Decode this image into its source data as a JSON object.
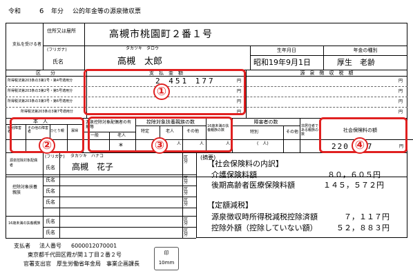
{
  "header": {
    "era": "令和",
    "year": "6",
    "year_unit": "年分",
    "title": "公的年金等の源泉徴収票"
  },
  "recipient": {
    "side_label": "支払を受ける者",
    "address_label": "住所又は居所",
    "address": "高槻市桃園町２番１号",
    "furigana_label": "(フリガナ)",
    "furigana": "タカツキ　タロウ",
    "name_label": "氏名",
    "name": "高槻　太郎",
    "birthdate_label": "生年月日",
    "birthdate": "昭和19年9月1日",
    "pension_type_label": "年金の種別",
    "pension_type": "厚生　老齢"
  },
  "payment": {
    "category_label": "区　　分",
    "amount_label": "支　払　金　額",
    "withholding_label": "源　泉　徴　収　税　額",
    "rows": [
      {
        "label": "所得税法第203条の3第1号・第4号適用分",
        "amount": "2 451 177",
        "unit": "円",
        "tax_unit": "円"
      },
      {
        "label": "所得税法第203条の3第2号・第5号適用分",
        "amount": "",
        "unit": "円",
        "tax_unit": "円"
      },
      {
        "label": "所得税法第203条の3第3号・第6号適用分",
        "amount": "",
        "unit": "円",
        "tax_unit": "円"
      },
      {
        "label": "所得税法第203条の3第7号適用分",
        "amount": "",
        "unit": "円",
        "tax_unit": "円"
      }
    ]
  },
  "deductions": {
    "honnin_label": "本　人",
    "tokubetsu_label": "特別障害者",
    "sonota_label": "その他の障害者",
    "hitorioya_label": "ひとり親",
    "kafu_label": "寡婦",
    "spouse_label": "源泉控除対象配偶者の有無等",
    "ippan_label": "一般",
    "rojin_label": "老人",
    "spouse_mark": "*",
    "dependents_label": "控除対象扶養親族の数",
    "tokutei_label": "特定",
    "dep_rojin_label": "老人",
    "dep_other_label": "その他",
    "nin": "人",
    "under16_label": "16歳未満の扶養親族の数",
    "disabled_label": "障害者の数",
    "disabled_tokubetsu": "特別",
    "disabled_sonota": "その他",
    "disabled_sample": "(　人)",
    "nonresident_label": "非居住者である親族の数",
    "insurance_label": "社会保険料の額",
    "insurance_amount": "220 177",
    "insurance_unit": "円"
  },
  "family": {
    "spouse_side_label": "源泉控除対象配偶者",
    "furigana": "タカツキ　ハナコ",
    "furigana_label": "(フリガナ)",
    "name_label": "氏名",
    "spouse_name": "高槻　花子",
    "dependents_side_label": "控除対象扶養親族",
    "under16_side_label": "16歳未満の扶養親族",
    "kubun_label": "区分"
  },
  "remarks": {
    "label": "(摘要)",
    "section1_title": "【社会保険料の内訳】",
    "kaigo_label": "介護保険料額",
    "kaigo_value": "８０，６０５円",
    "kouki_label": "後期高齢者医療保険料額",
    "kouki_value": "１４５，５７２円",
    "section2_title": "【定額減税】",
    "gensen_label": "源泉徴収時所得税減税控除済額",
    "gensen_value": "７，１１７円",
    "kojogai_label": "控除外額（控除していない額）",
    "kojogai_value": "５２，８８３円"
  },
  "payer": {
    "label": "支払者",
    "corp_number_label": "法人番号",
    "corp_number": "6000012070001",
    "address": "東京都千代田区霞が関１丁目２番２号",
    "title_line": "官署支出官　厚生労働省年金局　事業企画課長",
    "stamp_label": "印",
    "stamp_size": "10mm"
  },
  "annotations": [
    "①",
    "②",
    "③",
    "④"
  ],
  "colors": {
    "annotation": "#e02020",
    "line": "#000000"
  }
}
